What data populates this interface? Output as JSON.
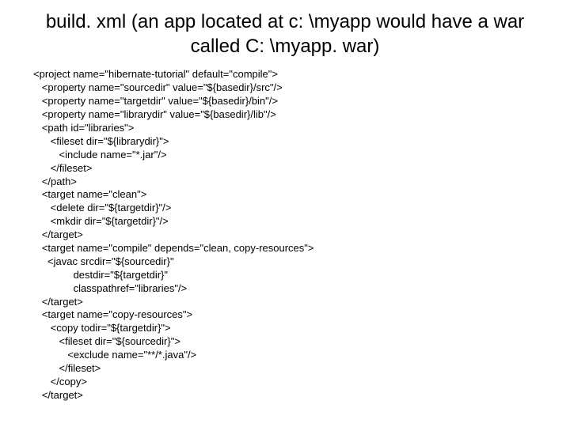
{
  "title": "build. xml (an app located at c: \\myapp would have a war called C: \\myapp. war)",
  "code": "<project name=\"hibernate-tutorial\" default=\"compile\">\n   <property name=\"sourcedir\" value=\"${basedir}/src\"/>\n   <property name=\"targetdir\" value=\"${basedir}/bin\"/>\n   <property name=\"librarydir\" value=\"${basedir}/lib\"/>\n   <path id=\"libraries\">\n      <fileset dir=\"${librarydir}\">\n         <include name=\"*.jar\"/>\n      </fileset>\n   </path>\n   <target name=\"clean\">\n      <delete dir=\"${targetdir}\"/>\n      <mkdir dir=\"${targetdir}\"/>\n   </target>\n   <target name=\"compile\" depends=\"clean, copy-resources\">\n     <javac srcdir=\"${sourcedir}\"\n              destdir=\"${targetdir}\"\n              classpathref=\"libraries\"/>\n   </target>\n   <target name=\"copy-resources\">\n      <copy todir=\"${targetdir}\">\n         <fileset dir=\"${sourcedir}\">\n            <exclude name=\"**/*.java\"/>\n         </fileset>\n      </copy>\n   </target>"
}
